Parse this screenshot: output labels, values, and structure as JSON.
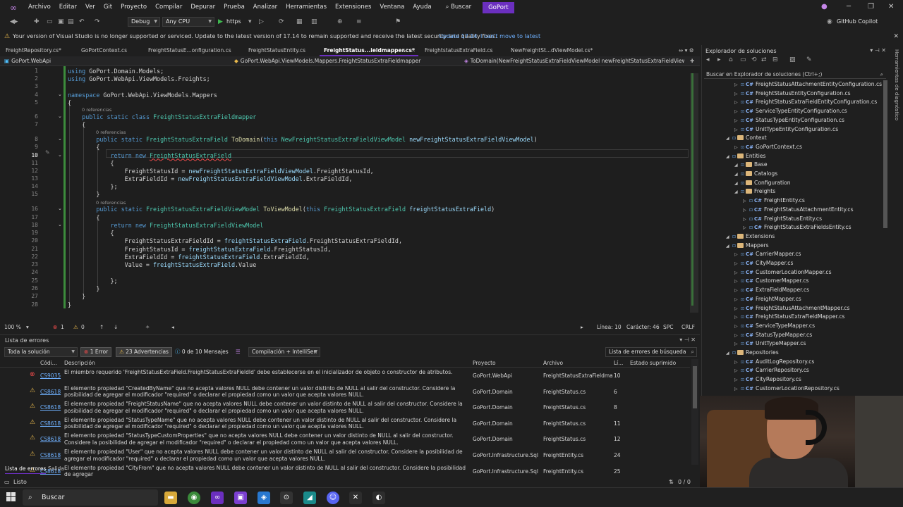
{
  "menubar": {
    "items": [
      "Archivo",
      "Editar",
      "Ver",
      "Git",
      "Proyecto",
      "Compilar",
      "Depurar",
      "Prueba",
      "Analizar",
      "Herramientas",
      "Extensiones",
      "Ventana",
      "Ayuda"
    ],
    "search_label": "Buscar",
    "solution_name": "GoPort"
  },
  "toolbar": {
    "config": "Debug",
    "platform": "Any CPU",
    "run_target": "https",
    "copilot_label": "GitHub Copilot"
  },
  "infobar": {
    "message": "Your version of Visual Studio is no longer supported or serviced. Update to the latest version of 17.14 to remain supported and receive the latest security and quality fixes.",
    "update_link": "Update 17.14",
    "cant_move_link": "I can't move to latest"
  },
  "tabs": [
    {
      "label": "FreightRepository.cs*",
      "active": false
    },
    {
      "label": "GoPortContext.cs",
      "active": false
    },
    {
      "label": "FreightStatusE...onfiguration.cs",
      "active": false
    },
    {
      "label": "FreightStatusEntity.cs",
      "active": false
    },
    {
      "label": "FreightStatus...ieldmapper.cs*",
      "active": true
    },
    {
      "label": "FreightstatusExtraField.cs",
      "active": false
    },
    {
      "label": "NewFreightSt...dViewModel.cs*",
      "active": false
    }
  ],
  "navbar": {
    "project": "GoPort.WebApi",
    "type": "GoPort.WebApi.ViewModels.Mappers.FreightStatusExtraFieldmapper",
    "member": "ToDomain(NewFreightStatusExtraFieldViewModel newFreightStatusExtraFieldViewModel"
  },
  "editor": {
    "current_line": 10,
    "codelens": [
      "0 referencias",
      "0 referencias",
      "0 referencias"
    ],
    "lines": [
      {
        "n": "1",
        "t": "using GoPort.Domain.Models;"
      },
      {
        "n": "2",
        "t": "using GoPort.WebApi.ViewModels.Freights;"
      },
      {
        "n": "3",
        "t": ""
      },
      {
        "n": "4",
        "t": "namespace GoPort.WebApi.ViewModels.Mappers"
      },
      {
        "n": "5",
        "t": "{"
      },
      {
        "n": "6",
        "t": "    public static class FreightStatusExtraFieldmapper"
      },
      {
        "n": "7",
        "t": "    {"
      },
      {
        "n": "8",
        "t": "        public static FreightStatusExtraField ToDomain(this NewFreightStatusExtraFieldViewModel newFreightStatusExtraFieldViewModel)"
      },
      {
        "n": "9",
        "t": "        {"
      },
      {
        "n": "10",
        "t": "            return new FreightStatusExtraField"
      },
      {
        "n": "11",
        "t": "            {"
      },
      {
        "n": "12",
        "t": "                FreightStatusId = newFreightStatusExtraFieldViewModel.FreightStatusId,"
      },
      {
        "n": "13",
        "t": "                ExtraFieldId = newFreightStatusExtraFieldViewModel.ExtraFieldId,"
      },
      {
        "n": "14",
        "t": "            };"
      },
      {
        "n": "15",
        "t": "        }"
      },
      {
        "n": "16",
        "t": "        public static FreightStatusExtraFieldViewModel ToViewModel(this FreightStatusExtraField freightStatusExtraField)"
      },
      {
        "n": "17",
        "t": "        {"
      },
      {
        "n": "18",
        "t": "            return new FreightStatusExtraFieldViewModel"
      },
      {
        "n": "19",
        "t": "            {"
      },
      {
        "n": "20",
        "t": "                FreightStatusExtraFieldId = freightStatusExtraField.FreightStatusExtraFieldId,"
      },
      {
        "n": "21",
        "t": "                FreightStatusId = freightStatusExtraField.FreightStatusId,"
      },
      {
        "n": "22",
        "t": "                ExtraFieldId = freightStatusExtraField.ExtraFieldId,"
      },
      {
        "n": "23",
        "t": "                Value = freightStatusExtraField.Value"
      },
      {
        "n": "24",
        "t": ""
      },
      {
        "n": "25",
        "t": "            };"
      },
      {
        "n": "26",
        "t": "        }"
      },
      {
        "n": "27",
        "t": "    }"
      },
      {
        "n": "28",
        "t": "}"
      }
    ]
  },
  "editor_status": {
    "zoom": "100 %",
    "errors": "1",
    "warnings": "0",
    "line": "Línea: 10",
    "char": "Carácter: 46",
    "spc": "SPC",
    "crlf": "CRLF"
  },
  "errorlist": {
    "title": "Lista de errores",
    "scope": "Toda la solución",
    "errors_chip": "1 Error",
    "warnings_chip": "23 Advertencias",
    "messages_chip": "0 de 10 Mensajes",
    "build_filter": "Compilación + IntelliSen",
    "search_placeholder": "Lista de errores de búsqueda",
    "columns": {
      "code": "Códi...",
      "desc": "Descripción",
      "project": "Proyecto",
      "file": "Archivo",
      "line": "Lí...",
      "suppressed": "Estado suprimido"
    },
    "rows": [
      {
        "sev": "error",
        "code": "CS9035",
        "desc": "El miembro requerido 'FreightStatusExtraField.FreightStatusExtraFieldId' debe establecerse en el inicializador de objeto o constructor de atributos.",
        "project": "GoPort.WebApi",
        "file": "FreightStatusExtraFieldma...",
        "line": "10"
      },
      {
        "sev": "warning",
        "code": "CS8618",
        "desc": "El elemento propiedad \"CreatedByName\" que no acepta valores NULL debe contener un valor distinto de NULL al salir del constructor. Considere la posibilidad de agregar el modificador \"required\" o declarar el propiedad como un valor que acepta valores NULL.",
        "project": "GoPort.Domain",
        "file": "FreightStatus.cs",
        "line": "6"
      },
      {
        "sev": "warning",
        "code": "CS8618",
        "desc": "El elemento propiedad \"FreightStatusName\" que no acepta valores NULL debe contener un valor distinto de NULL al salir del constructor. Considere la posibilidad de agregar el modificador \"required\" o declarar el propiedad como un valor que acepta valores NULL.",
        "project": "GoPort.Domain",
        "file": "FreightStatus.cs",
        "line": "8"
      },
      {
        "sev": "warning",
        "code": "CS8618",
        "desc": "El elemento propiedad \"StatusTypeName\" que no acepta valores NULL debe contener un valor distinto de NULL al salir del constructor. Considere la posibilidad de agregar el modificador \"required\" o declarar el propiedad como un valor que acepta valores NULL.",
        "project": "GoPort.Domain",
        "file": "FreightStatus.cs",
        "line": "11"
      },
      {
        "sev": "warning",
        "code": "CS8618",
        "desc": "El elemento propiedad \"StatusTypeCustomProperties\" que no acepta valores NULL debe contener un valor distinto de NULL al salir del constructor. Considere la posibilidad de agregar el modificador \"required\" o declarar el propiedad como un valor que acepta valores NULL.",
        "project": "GoPort.Domain",
        "file": "FreightStatus.cs",
        "line": "12"
      },
      {
        "sev": "warning",
        "code": "CS8618",
        "desc": "El elemento propiedad \"User\" que no acepta valores NULL debe contener un valor distinto de NULL al salir del constructor. Considere la posibilidad de agregar el modificador \"required\" o declarar el propiedad como un valor que acepta valores NULL.",
        "project": "GoPort.Infrastructure.Sql",
        "file": "FreightEntity.cs",
        "line": "24"
      },
      {
        "sev": "warning",
        "code": "CS8618",
        "desc": "El elemento propiedad \"CityFrom\" que no acepta valores NULL debe contener un valor distinto de NULL al salir del constructor. Considere la posibilidad de agregar",
        "project": "GoPort.Infrastructure.Sql",
        "file": "FreightEntity.cs",
        "line": "25"
      }
    ]
  },
  "bottom_tabs": [
    "Lista de errores",
    "Salida"
  ],
  "solution_explorer": {
    "title": "Explorador de soluciones",
    "search_placeholder": "Buscar en Explorador de soluciones (Ctrl+;)",
    "items": [
      {
        "label": "FreightStatusAttachmentEntityConfiguration.cs",
        "kind": "cs",
        "indent": 3
      },
      {
        "label": "FreightStatusEntityConfiguration.cs",
        "kind": "cs",
        "indent": 3
      },
      {
        "label": "FreightStatusExtraFieldEntityConfiguration.cs",
        "kind": "cs",
        "indent": 3
      },
      {
        "label": "ServiceTypeEntityConfiguration.cs",
        "kind": "cs",
        "indent": 3
      },
      {
        "label": "StatusTypeEntityConfiguration.cs",
        "kind": "cs",
        "indent": 3
      },
      {
        "label": "UnitTypeEntityConfiguration.cs",
        "kind": "cs",
        "indent": 3
      },
      {
        "label": "Context",
        "kind": "folder",
        "indent": 2
      },
      {
        "label": "GoPortContext.cs",
        "kind": "cs",
        "indent": 3
      },
      {
        "label": "Entities",
        "kind": "folder",
        "indent": 2
      },
      {
        "label": "Base",
        "kind": "folder",
        "indent": 3
      },
      {
        "label": "Catalogs",
        "kind": "folder",
        "indent": 3
      },
      {
        "label": "Configuration",
        "kind": "folder",
        "indent": 3
      },
      {
        "label": "Freights",
        "kind": "folder",
        "indent": 3
      },
      {
        "label": "FreightEntity.cs",
        "kind": "cs",
        "indent": 4
      },
      {
        "label": "FreightStatusAttachmentEntity.cs",
        "kind": "cs",
        "indent": 4
      },
      {
        "label": "FreightStatusEntity.cs",
        "kind": "cs",
        "indent": 4
      },
      {
        "label": "FreightStatusExtraFieldsEntity.cs",
        "kind": "cs",
        "indent": 4
      },
      {
        "label": "Extensions",
        "kind": "folder",
        "indent": 2
      },
      {
        "label": "Mappers",
        "kind": "folder",
        "indent": 2
      },
      {
        "label": "CarrierMapper.cs",
        "kind": "cs",
        "indent": 3
      },
      {
        "label": "CityMapper.cs",
        "kind": "cs",
        "indent": 3
      },
      {
        "label": "CustomerLocationMapper.cs",
        "kind": "cs",
        "indent": 3
      },
      {
        "label": "CustomerMapper.cs",
        "kind": "cs",
        "indent": 3
      },
      {
        "label": "ExtraFieldMapper.cs",
        "kind": "cs",
        "indent": 3
      },
      {
        "label": "FreightMapper.cs",
        "kind": "cs",
        "indent": 3
      },
      {
        "label": "FreightStatusAttachmentMapper.cs",
        "kind": "cs",
        "indent": 3
      },
      {
        "label": "FreightStatusExtraFieldMapper.cs",
        "kind": "cs",
        "indent": 3
      },
      {
        "label": "ServiceTypeMapper.cs",
        "kind": "cs",
        "indent": 3
      },
      {
        "label": "StatusTypeMapper.cs",
        "kind": "cs",
        "indent": 3
      },
      {
        "label": "UnitTypeMapper.cs",
        "kind": "cs",
        "indent": 3
      },
      {
        "label": "Repositories",
        "kind": "folder",
        "indent": 2
      },
      {
        "label": "AuditLogRepository.cs",
        "kind": "cs",
        "indent": 3
      },
      {
        "label": "CarrierRepository.cs",
        "kind": "cs",
        "indent": 3
      },
      {
        "label": "CityRepository.cs",
        "kind": "cs",
        "indent": 3
      },
      {
        "label": "CustomerLocationRepository.cs",
        "kind": "cs",
        "indent": 3
      }
    ]
  },
  "diagnostics_label": "Herramientas de diagnóstico",
  "vs_status": {
    "ready": "Listo",
    "changes": "0 / 0"
  },
  "taskbar": {
    "search_label": "Buscar"
  },
  "colors": {
    "accent": "#6b2fbf",
    "error": "#f14c4c",
    "warning": "#e8b84c"
  }
}
